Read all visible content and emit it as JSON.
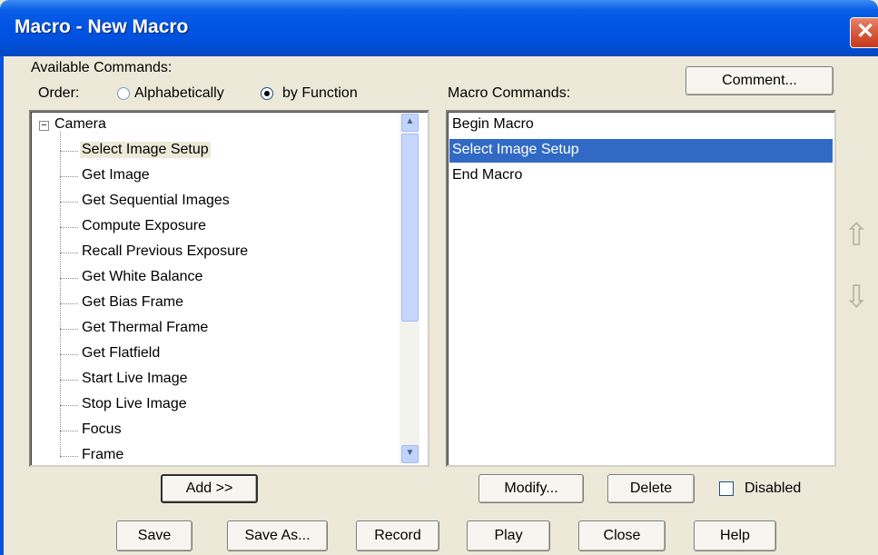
{
  "window": {
    "title": "Macro - New Macro"
  },
  "available": {
    "label": "Available Commands:",
    "order_label": "Order:",
    "order_options": [
      "Alphabetically",
      "by Function"
    ],
    "order_selected": "by Function"
  },
  "tree": {
    "root": "Camera",
    "expander": "−",
    "items": [
      "Select Image Setup",
      "Get Image",
      "Get Sequential Images",
      "Compute Exposure",
      "Recall Previous Exposure",
      "Get White Balance",
      "Get Bias Frame",
      "Get Thermal Frame",
      "Get Flatfield",
      "Start Live Image",
      "Stop Live Image",
      "Focus",
      "Frame"
    ],
    "selected": "Select Image Setup"
  },
  "macro": {
    "label": "Macro Commands:",
    "items": [
      "Begin Macro",
      "Select Image Setup",
      "End Macro"
    ],
    "selected": "Select Image Setup"
  },
  "buttons": {
    "comment": "Comment...",
    "add": "Add >>",
    "modify": "Modify...",
    "delete": "Delete",
    "disabled": "Disabled",
    "save": "Save",
    "save_as": "Save As...",
    "record": "Record",
    "play": "Play",
    "close": "Close",
    "help": "Help"
  },
  "icons": {
    "close": "close-icon",
    "up": "up-arrow-icon",
    "down": "down-arrow-icon",
    "scroll_up": "chevron-up-icon",
    "scroll_down": "chevron-down-icon"
  },
  "colors": {
    "titlebar": "#0054e3",
    "selection": "#316ac5",
    "window_bg": "#ece9d8"
  }
}
